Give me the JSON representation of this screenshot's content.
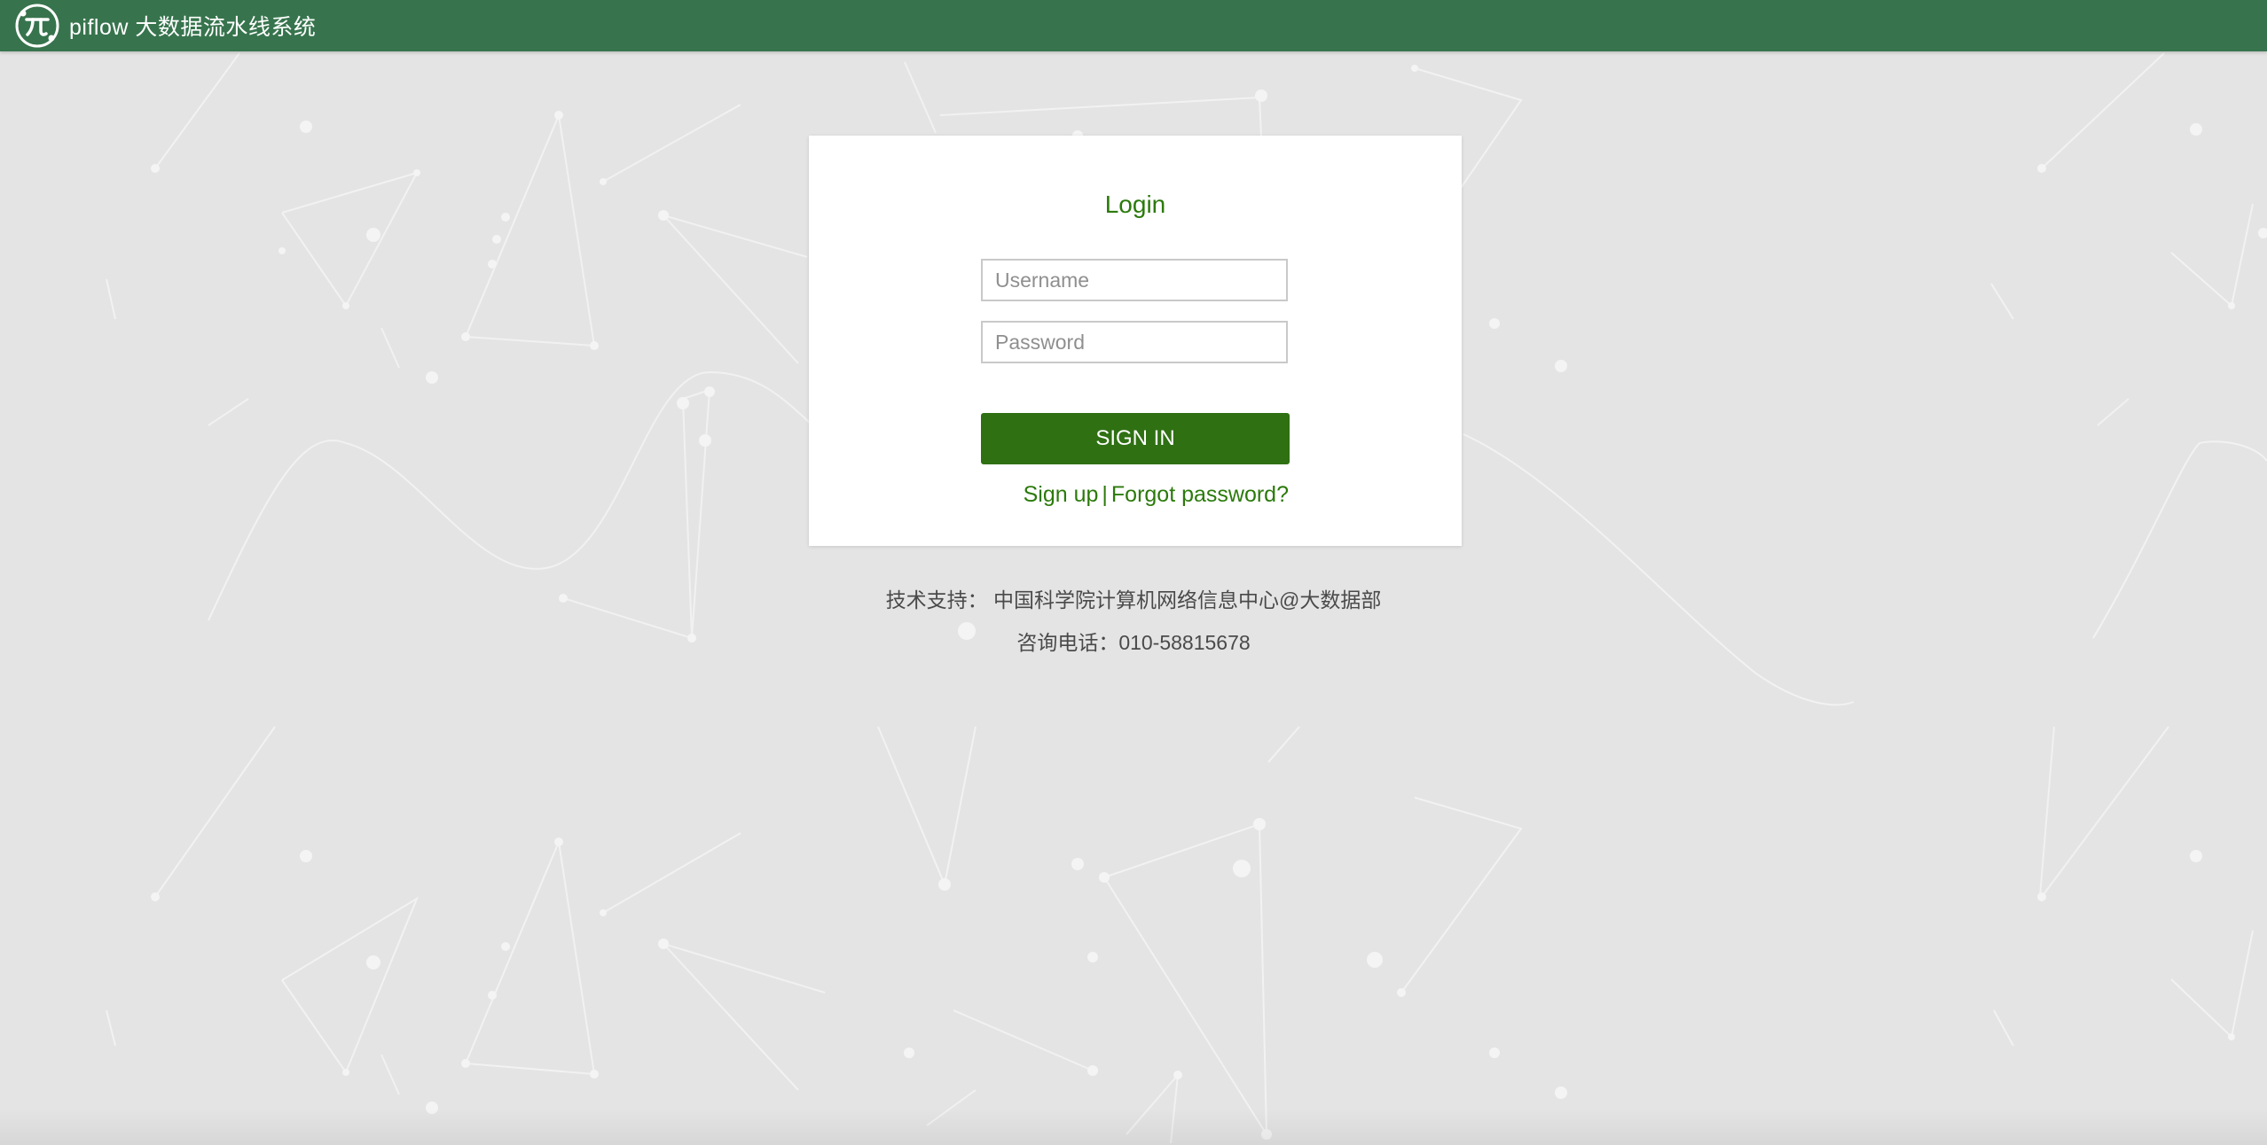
{
  "header": {
    "app_title": "piflow 大数据流水线系统",
    "logo_icon": "piflow-logo-icon",
    "background_color": "#37744d"
  },
  "login": {
    "title": "Login",
    "username_placeholder": "Username",
    "username_value": "",
    "password_placeholder": "Password",
    "password_value": "",
    "signin_label": "SIGN IN",
    "signup_label": "Sign up",
    "separator": "|",
    "forgot_label": "Forgot password?",
    "accent_color": "#2f7013"
  },
  "footer": {
    "support": "技术支持： 中国科学院计算机网络信息中心@大数据部",
    "phone": "咨询电话：010-58815678"
  }
}
